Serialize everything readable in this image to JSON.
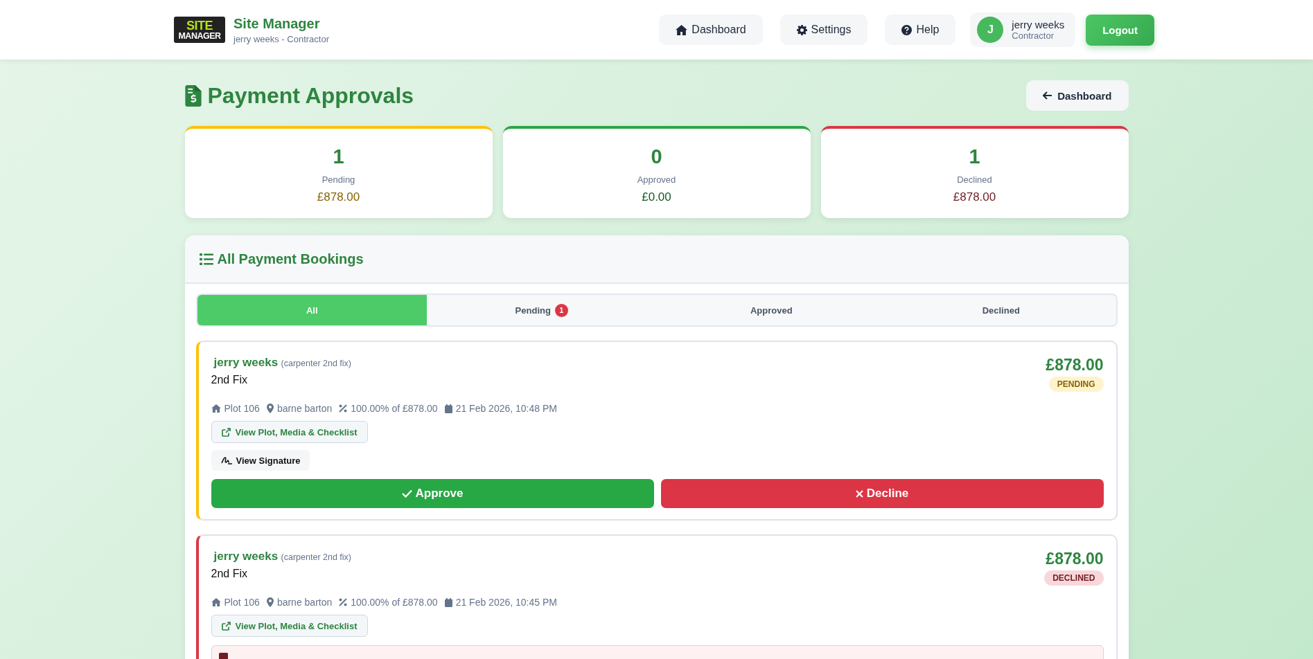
{
  "header": {
    "logo": {
      "line1": "SITE",
      "line2": "MANAGER"
    },
    "app_name": "Site Manager",
    "subtitle": "jerry weeks - Contractor",
    "nav": [
      {
        "label": "Dashboard",
        "kind": "home"
      },
      {
        "label": "Settings",
        "kind": "gear"
      },
      {
        "label": "Help",
        "kind": "help"
      }
    ],
    "user": {
      "initial": "J",
      "name": "jerry weeks",
      "role": "Contractor"
    },
    "logout": "Logout"
  },
  "page": {
    "title": "Payment Approvals",
    "back": "Dashboard"
  },
  "stats": [
    {
      "kind": "pending",
      "count": "1",
      "label": "Pending",
      "amount": "£878.00"
    },
    {
      "kind": "approved",
      "count": "0",
      "label": "Approved",
      "amount": "£0.00"
    },
    {
      "kind": "declined",
      "count": "1",
      "label": "Declined",
      "amount": "£878.00"
    }
  ],
  "bookings": {
    "title": "All Payment Bookings",
    "tabs": [
      {
        "label": "All",
        "selected": true
      },
      {
        "label": "Pending",
        "selected": false,
        "badge": "1"
      },
      {
        "label": "Approved",
        "selected": false
      },
      {
        "label": "Declined",
        "selected": false
      }
    ],
    "items": [
      {
        "kind": "pending",
        "name": "jerry weeks",
        "role": "(carpenter 2nd fix)",
        "task": "2nd Fix",
        "amount": "£878.00",
        "badge": "PENDING",
        "plot": "Plot 106",
        "location": "barne barton",
        "percent": "100.00% of £878.00",
        "date": "21 Feb 2026, 10:48 PM",
        "link": "View Plot, Media & Checklist",
        "signature": "View Signature",
        "approve": "Approve",
        "decline": "Decline"
      },
      {
        "kind": "declined",
        "name": "jerry weeks",
        "role": "(carpenter 2nd fix)",
        "task": "2nd Fix",
        "amount": "£878.00",
        "badge": "DECLINED",
        "plot": "Plot 106",
        "location": "barne barton",
        "percent": "100.00% of £878.00",
        "date": "21 Feb 2026, 10:45 PM",
        "link": "View Plot, Media & Checklist",
        "decline_note": true
      }
    ]
  }
}
